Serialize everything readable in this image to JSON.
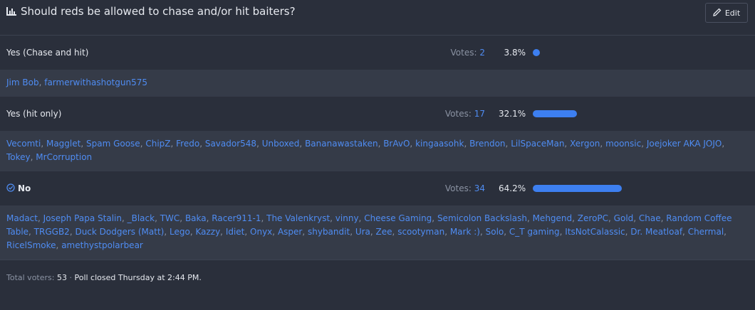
{
  "poll": {
    "title": "Should reds be allowed to chase and/or hit baiters?",
    "edit_label": "Edit"
  },
  "options": [
    {
      "label": "Yes (Chase and hit)",
      "votes_label": "Votes:",
      "votes": "2",
      "percent": "3.8%",
      "fraction": 0.038,
      "selected": false,
      "voters": [
        "Jim Bob",
        "farmerwithashotgun575"
      ]
    },
    {
      "label": "Yes (hit only)",
      "votes_label": "Votes:",
      "votes": "17",
      "percent": "32.1%",
      "fraction": 0.321,
      "selected": false,
      "voters": [
        "Vecomti",
        "Magglet",
        "Spam Goose",
        "ChipZ",
        "Fredo",
        "Savador548",
        "Unboxed",
        "Bananawastaken",
        "BrAvO",
        "kingaasohk",
        "Brendon",
        "LilSpaceMan",
        "Xergon",
        "moonsic",
        "Joejoker AKA JOJO",
        "Tokey",
        "MrCorruption"
      ]
    },
    {
      "label": "No",
      "votes_label": "Votes:",
      "votes": "34",
      "percent": "64.2%",
      "fraction": 0.642,
      "selected": true,
      "voters": [
        "Madact",
        "Joseph Papa Stalin",
        "_Black",
        "TWC",
        "Baka",
        "Racer911-1",
        "The Valenkryst",
        "vinny",
        "Cheese Gaming",
        "Semicolon Backslash",
        "Mehgend",
        "ZeroPC",
        "Gold",
        "Chae",
        "Random Coffee Table",
        "TRGGB2",
        "Duck Dodgers (Matt)",
        "Lego",
        "Kazzy",
        "Idiet",
        "Onyx",
        "Asper",
        "shybandit",
        "Ura",
        "Zee",
        "scootyman",
        "Mark :)",
        "Solo",
        "C_T gaming",
        "ItsNotCalassic",
        "Dr. Meatloaf",
        "Chermal",
        "RicelSmoke",
        "amethystpolarbear"
      ]
    }
  ],
  "footer": {
    "total_label": "Total voters:",
    "total": "53",
    "separator": "·",
    "closed_text": "Poll closed Thursday at 2:44 PM."
  },
  "colors": {
    "accent": "#3d7ff0",
    "link": "#4f8cf2",
    "background": "#2a2f3b",
    "voters_background": "#353b48"
  },
  "icons": {
    "title": "bar-chart-icon",
    "edit": "pencil-icon",
    "selected": "check-circle-icon"
  }
}
